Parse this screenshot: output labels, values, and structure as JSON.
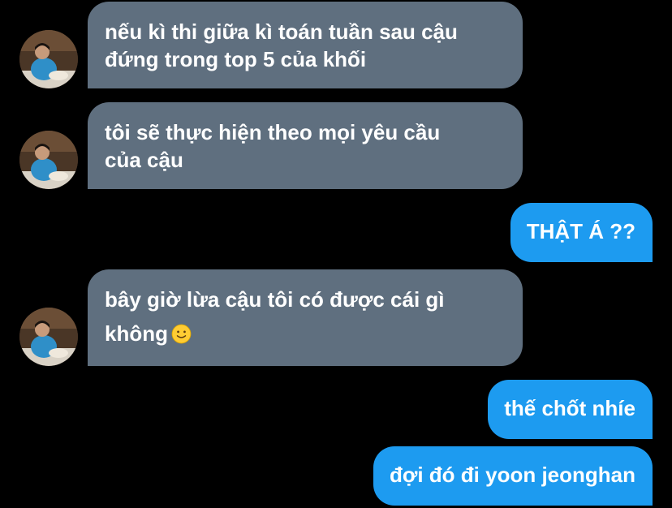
{
  "messages": [
    {
      "direction": "incoming",
      "lines": [
        "nếu kì thi giữa kì toán tuần sau cậu",
        "đứng trong top 5 của khối"
      ]
    },
    {
      "direction": "incoming",
      "lines": [
        "tôi sẽ thực hiện theo mọi yêu cầu",
        "của cậu"
      ]
    },
    {
      "direction": "outgoing",
      "lines": [
        "THẬT Á ??"
      ]
    },
    {
      "direction": "incoming",
      "lines": [
        "bây giờ lừa cậu tôi có được cái gì",
        "không"
      ],
      "emoji": "slightly-smiling-face-icon"
    },
    {
      "direction": "outgoing",
      "lines": [
        "thế chốt nhíe"
      ]
    },
    {
      "direction": "outgoing",
      "lines": [
        "đợi đó đi yoon jeonghan"
      ]
    }
  ],
  "colors": {
    "background": "#000000",
    "incoming_bubble": "#5f6f7f",
    "outgoing_bubble": "#1d9bf0",
    "text": "#ffffff"
  }
}
